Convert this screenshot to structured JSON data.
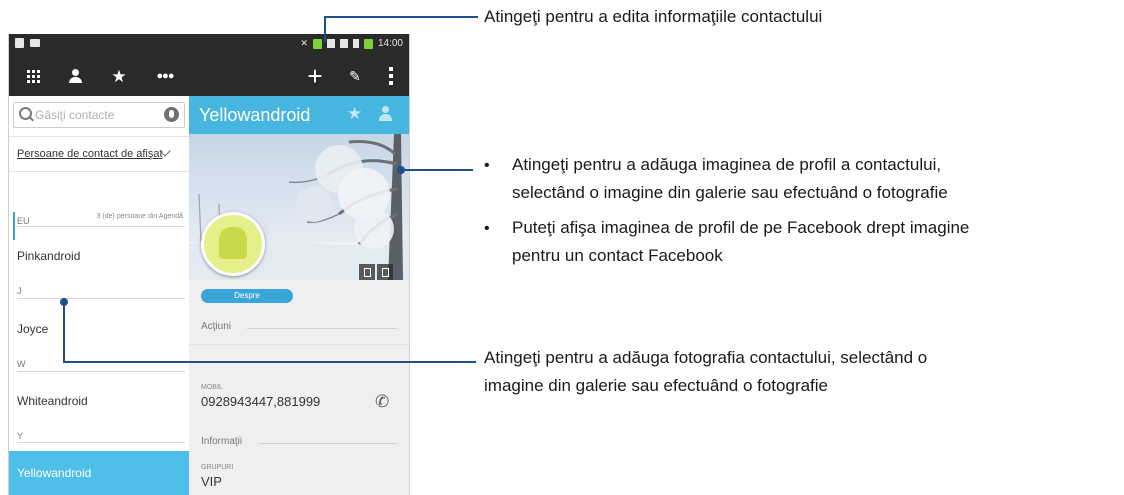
{
  "device": {
    "status_bar": {
      "time": "14:00"
    },
    "action_bar": {
      "apps_icon": "grid-icon",
      "contacts_icon": "person-icon",
      "favorites_icon": "star-icon",
      "groups_icon": "group-icon",
      "add_icon": "plus-icon",
      "edit_icon": "pencil-icon",
      "menu_icon": "more-vert-icon"
    },
    "left_panel": {
      "search_placeholder": "Găsiţi contacte",
      "filter_label": "Persoane de contact de afişat",
      "eu_count": "3 (de) persoane din Agendă",
      "sections": [
        {
          "letter": "EU",
          "contacts": [
            "Pinkandroid"
          ]
        },
        {
          "letter": "J",
          "contacts": [
            "Joyce"
          ]
        },
        {
          "letter": "W",
          "contacts": [
            "Whiteandroid"
          ]
        },
        {
          "letter": "Y",
          "contacts": [
            "Yellowandroid"
          ]
        }
      ]
    },
    "right_panel": {
      "contact_name": "Yellowandroid",
      "tab_label": "Despre",
      "actions_section": "Acţiuni",
      "phone_label": "MOBIL",
      "phone_value": "0928943447,881999",
      "info_section": "Informaţii",
      "groups_label": "GRUPURI",
      "groups_value": "VIP"
    }
  },
  "callouts": {
    "edit": "Atingeţi pentru a edita informaţiile contactului",
    "profile_bullet_1_line_1": "Atingeţi pentru a adăuga imaginea de profil a contactului,",
    "profile_bullet_1_line_2": "selectând o imagine din galerie sau efectuând o fotografie",
    "profile_bullet_2_line_1": "Puteţi afişa imaginea de profil de pe Facebook drept imagine",
    "profile_bullet_2_line_2": "pentru un contact Facebook",
    "photo_line_1": "Atingeţi pentru a adăuga fotografia contactului, selectând o",
    "photo_line_2": "imagine din galerie sau efectuând o fotografie",
    "bullet_char": "•"
  },
  "colors": {
    "action_bar": "#2a2a2a",
    "accent_blue": "#46b5e0",
    "selected_row": "#4dbfe8",
    "callout_line": "#1f4e8c"
  }
}
